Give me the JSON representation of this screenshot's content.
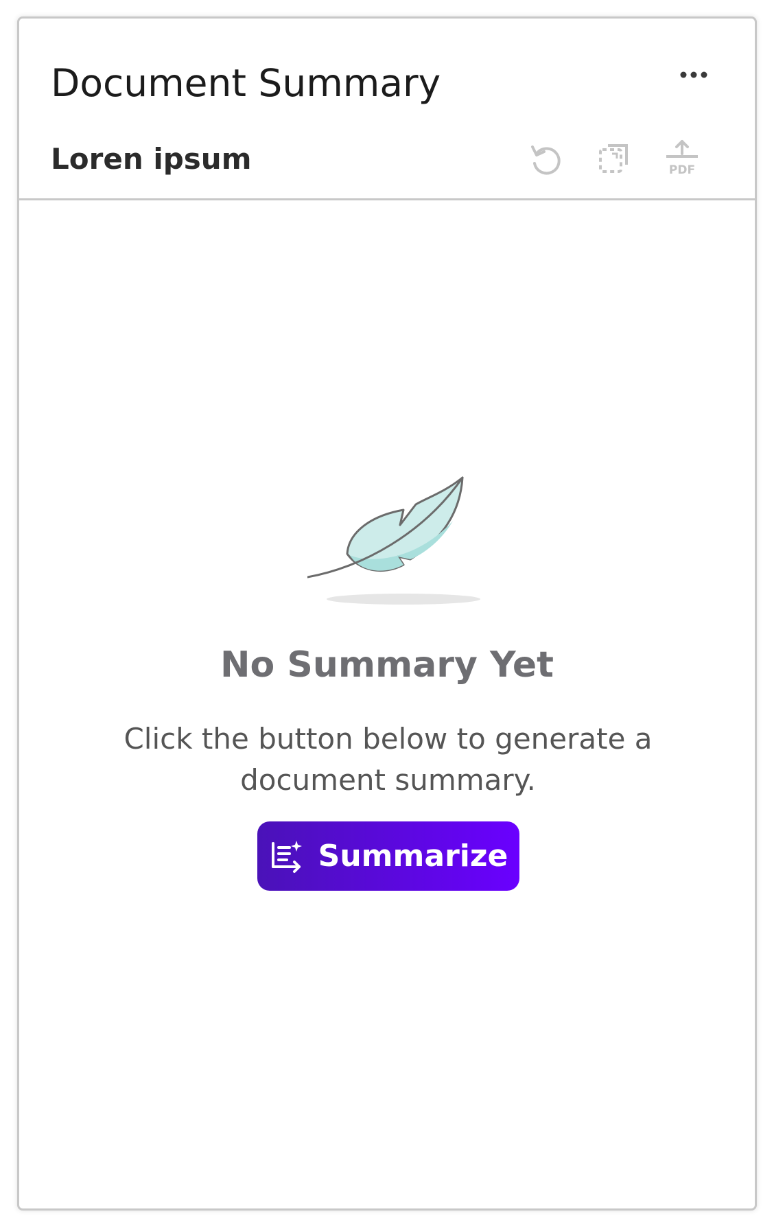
{
  "panel": {
    "title": "Document Summary",
    "subtitle": "Loren ipsum",
    "more_icon": "more-horizontal-icon"
  },
  "toolbar": {
    "regenerate_icon": "refresh-icon",
    "copy_icon": "copy-icon",
    "export_pdf_icon": "export-pdf-icon",
    "export_pdf_text": "PDF"
  },
  "empty_state": {
    "illustration": "feather-icon",
    "heading": "No Summary Yet",
    "description": "Click the button below to generate a document summary."
  },
  "summarize_button": {
    "label": "Summarize",
    "icon": "summarize-icon",
    "gradient_start": "#4a12b8",
    "gradient_end": "#6a00ff"
  }
}
